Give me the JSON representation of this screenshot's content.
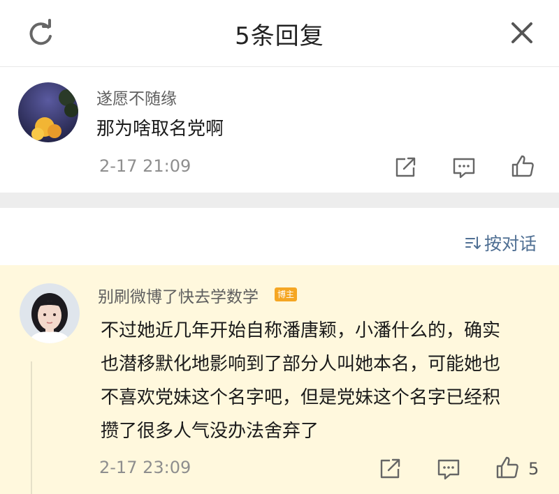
{
  "header": {
    "title": "5条回复",
    "left_icon": "refresh-icon",
    "right_icon": "close-icon"
  },
  "reply": {
    "username": "遂愿不随缘",
    "text": "那为啥取名党啊",
    "time": "2-17 21:09",
    "actions": [
      "share-icon",
      "comment-icon",
      "like-icon"
    ]
  },
  "sort": {
    "label": "按对话",
    "icon": "sort-icon"
  },
  "main_comment": {
    "username": "别刷微博了快去学数学",
    "badge": "博主",
    "lines": [
      "不过她近几年开始自称潘唐颖，小潘什么的，确实",
      "也潜移默化地影响到了部分人叫她本名，可能她也",
      "不喜欢党妹这个名字吧，但是党妹这个名字已经积",
      "攒了很多人气没办法舍弃了"
    ],
    "time": "2-17 23:09",
    "like_count": "5",
    "actions": [
      "share-icon",
      "comment-icon",
      "like-icon"
    ]
  },
  "colors": {
    "highlight_bg": "#fff8dd",
    "link": "#4f6f93",
    "badge": "#f5a623",
    "divider": "#ededed"
  }
}
